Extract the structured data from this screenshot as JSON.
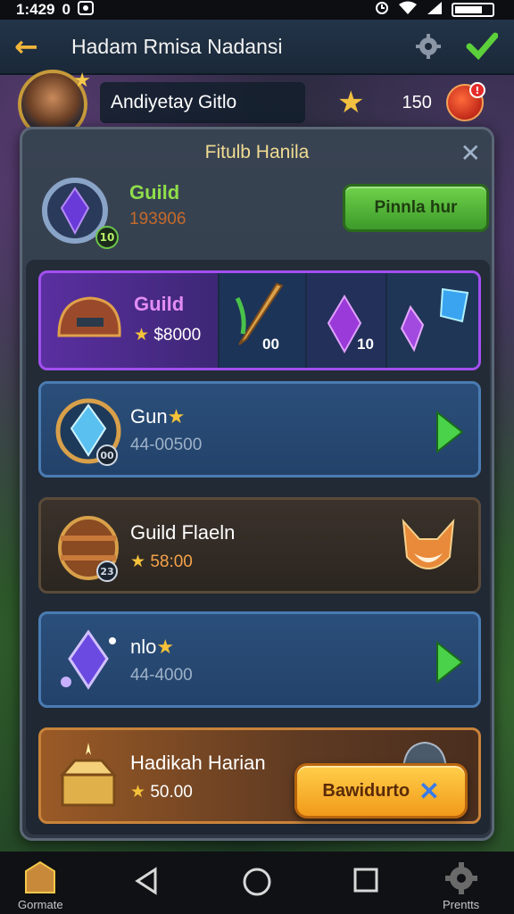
{
  "status_bar": {
    "time": "1:429",
    "indicator": "0"
  },
  "header": {
    "title": "Hadam Rmisa Nadansi"
  },
  "profile": {
    "name": "Andiyetay Gitlo",
    "currency": "150",
    "badge": "!"
  },
  "panel": {
    "title": "Fitulb Hanila",
    "guild": {
      "name": "Guild",
      "amount": "193906",
      "level": "10"
    },
    "action_button": "Pinnla hur"
  },
  "featured": {
    "name": "Guild",
    "price": "$8000",
    "cells": [
      {
        "count": "00"
      },
      {
        "count": "10"
      }
    ]
  },
  "items": [
    {
      "name": "Gun",
      "sub": "44-00500",
      "badge": "00"
    },
    {
      "name": "Guild Flaeln",
      "price": "58:00",
      "badge": "23"
    },
    {
      "name": "nlo",
      "sub": "44-4000"
    },
    {
      "name": "Hadikah Harian",
      "price": "50.00"
    }
  ],
  "claim_button": "Bawidurto",
  "nav": {
    "left_label": "Gormate",
    "right_label": "Prentts"
  },
  "colors": {
    "accent_green": "#6fd24a",
    "accent_gold": "#f5c23a",
    "featured_border": "#a24ff0"
  }
}
